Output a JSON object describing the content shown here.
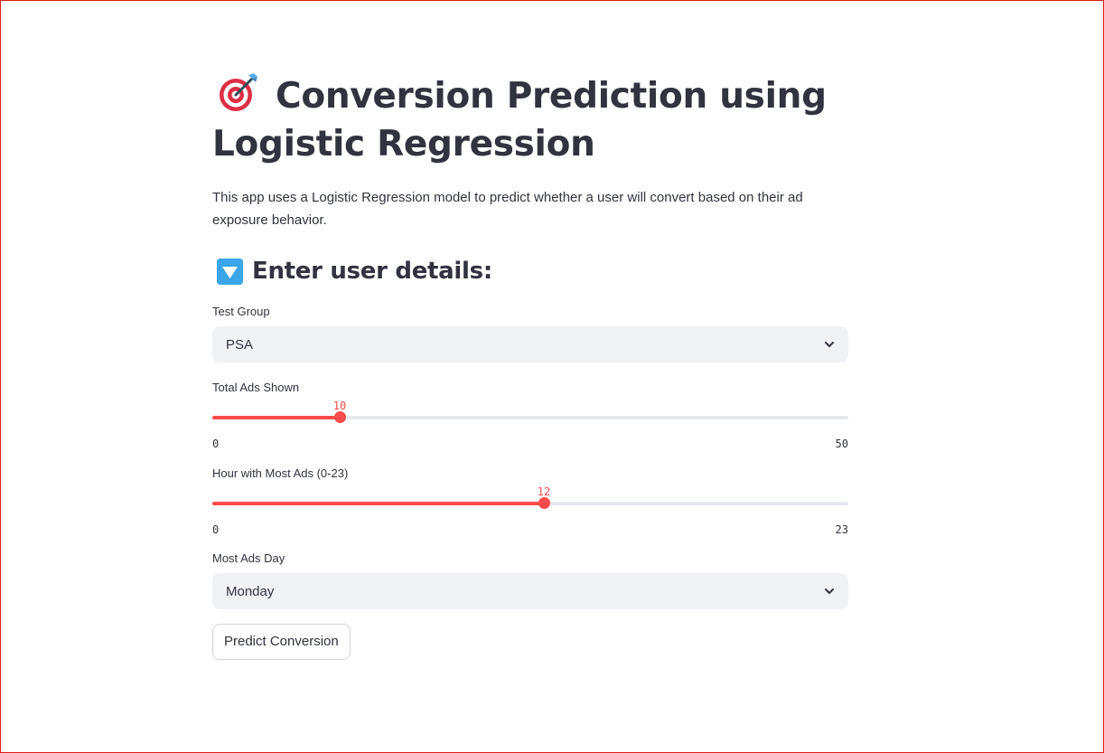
{
  "title": {
    "icon": "direct-hit-target-icon",
    "text": "Conversion Prediction using Logistic Regression"
  },
  "description": "This app uses a Logistic Regression model to predict whether a user will convert based on their ad exposure behavior.",
  "subheader": {
    "icon": "down-triangle-button-icon",
    "text": "Enter user details:"
  },
  "form": {
    "test_group": {
      "label": "Test Group",
      "value": "PSA"
    },
    "total_ads": {
      "label": "Total Ads Shown",
      "value": 10,
      "min": 0,
      "max": 50,
      "value_text": "10",
      "min_text": "0",
      "max_text": "50"
    },
    "hour_most_ads": {
      "label": "Hour with Most Ads (0-23)",
      "value": 12,
      "min": 0,
      "max": 23,
      "value_text": "12",
      "min_text": "0",
      "max_text": "23"
    },
    "most_ads_day": {
      "label": "Most Ads Day",
      "value": "Monday"
    },
    "predict_button": "Predict Conversion"
  },
  "colors": {
    "accent": "#ff4b4b",
    "text": "#31333f",
    "select_bg": "#f0f2f6",
    "track": "#e6e8ee",
    "frame_border": "#e01b1b"
  }
}
